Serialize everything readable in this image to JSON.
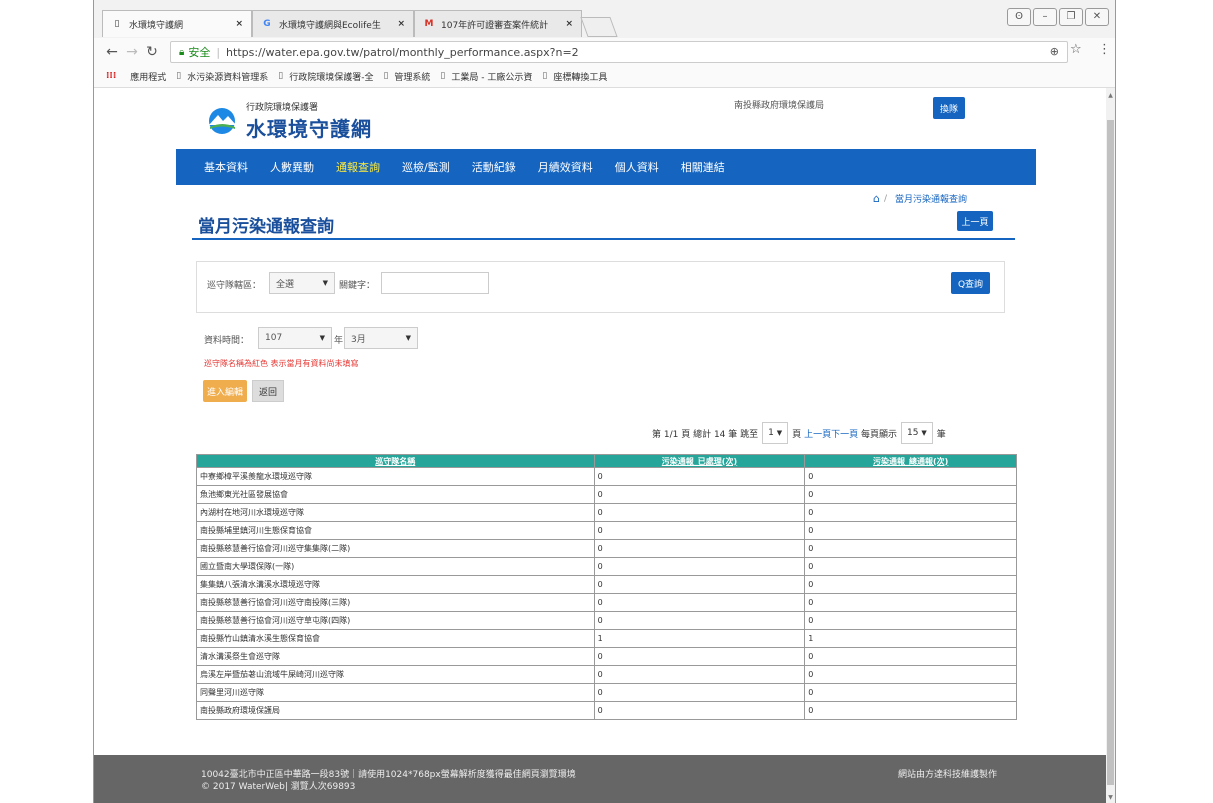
{
  "browser": {
    "tabs": [
      {
        "icon": "page",
        "title": "水環境守護網"
      },
      {
        "icon": "google",
        "title": "水環境守護網與Ecolife生"
      },
      {
        "icon": "gmail",
        "title": "107年許可證審查案件統計"
      }
    ],
    "url_secure_label": "安全",
    "url": "https://water.epa.gov.tw/patrol/monthly_performance.aspx?n=2",
    "bookmarks": [
      "應用程式",
      "水污染源資料管理系",
      "行政院環境保護署-全",
      "管理系統",
      "工業局 - 工廠公示資",
      "座標轉換工具"
    ]
  },
  "header": {
    "logo_line1": "行政院環境保護署",
    "logo_line2": "水環境守護網",
    "agency": "南投縣政府環境保護局",
    "logout": "換隊"
  },
  "nav": [
    "基本資料",
    "人數異動",
    "通報查詢",
    "巡檢/監測",
    "活動紀錄",
    "月績效資料",
    "個人資料",
    "相關連結"
  ],
  "nav_active": 2,
  "breadcrumb": "當月污染通報查詢",
  "page_title": "當月污染通報查詢",
  "back_button": "上一頁",
  "filter": {
    "district_label": "巡守隊轄區：",
    "district_value": "全選",
    "keyword_label": "關鍵字：",
    "keyword_value": "",
    "search_button": "Q查詢"
  },
  "period": {
    "label": "資料時間：",
    "year": "107",
    "year_unit": "年",
    "month": "3月"
  },
  "warning": "巡守隊名稱為紅色 表示當月有資料尚未填寫",
  "edit_button": "進入編輯",
  "return_button": "返回",
  "pager": {
    "page_info": "第 1/1 頁",
    "total": "總計 14 筆",
    "jump_label": "跳至",
    "page_value": "1",
    "page_unit": "頁",
    "prev": "上一頁",
    "next": "下一頁",
    "per_page_label": "每頁顯示",
    "per_page_value": "15",
    "per_page_unit": "筆"
  },
  "table": {
    "headers": [
      "巡守隊名稱",
      "污染通報_已處理(次)",
      "污染通報_總通報(次)"
    ],
    "rows": [
      [
        "中寮鄉樟平溪羨龍水環境巡守隊",
        "0",
        "0"
      ],
      [
        "魚池鄉東光社區發展協會",
        "0",
        "0"
      ],
      [
        "內湖村在地河川水環境巡守隊",
        "0",
        "0"
      ],
      [
        "南投縣埔里鎮河川生態保育協會",
        "0",
        "0"
      ],
      [
        "南投縣慈慧善行協會河川巡守集集隊(二隊)",
        "0",
        "0"
      ],
      [
        "國立暨南大學環保隊(一隊)",
        "0",
        "0"
      ],
      [
        "集集鎮八張清水溝溪水環境巡守隊",
        "0",
        "0"
      ],
      [
        "南投縣慈慧善行協會河川巡守南投隊(三隊)",
        "0",
        "0"
      ],
      [
        "南投縣慈慧善行協會河川巡守草屯隊(四隊)",
        "0",
        "0"
      ],
      [
        "南投縣竹山鎮清水溪生態保育協會",
        "1",
        "1"
      ],
      [
        "清水溝溪祭生會巡守隊",
        "0",
        "0"
      ],
      [
        "烏溪左岸暨茄荖山流域牛屎崎河川巡守隊",
        "0",
        "0"
      ],
      [
        "同聲里河川巡守隊",
        "0",
        "0"
      ],
      [
        "南投縣政府環境保護局",
        "0",
        "0"
      ]
    ]
  },
  "footer": {
    "line1": "10042臺北市中正區中華路一段83號｜請使用1024*768px螢幕解析度獲得最佳網頁瀏覽環境",
    "line2": "© 2017 WaterWeb| 瀏覽人次69893",
    "credit": "網站由方達科技維護製作"
  },
  "colors": {
    "primary": "#1565c0",
    "table_header": "#26a69a",
    "warning": "#e53935",
    "edit": "#f0ad4e"
  }
}
